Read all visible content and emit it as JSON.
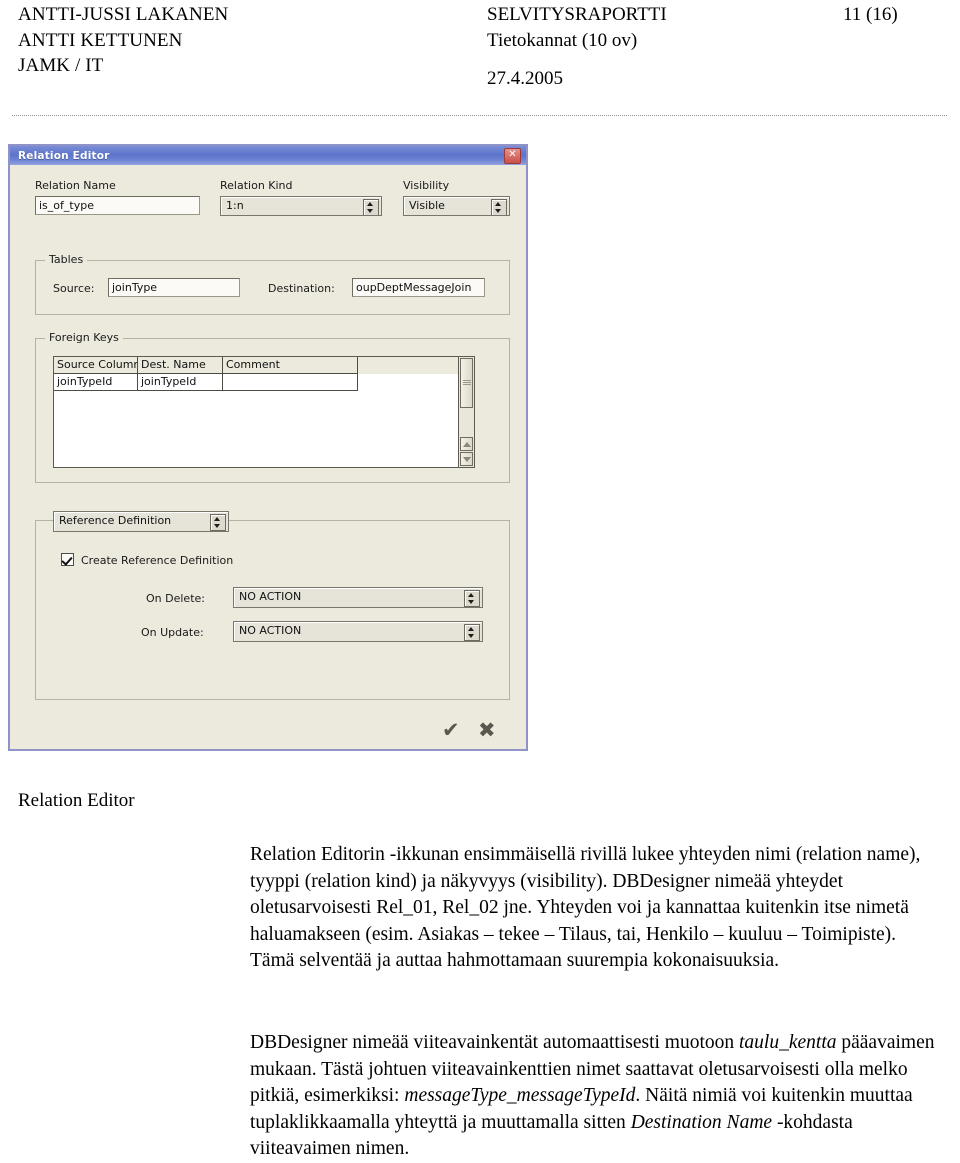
{
  "header": {
    "author_line_1": "ANTTI-JUSSI LAKANEN",
    "author_line_2": "ANTTI KETTUNEN",
    "org": "JAMK / IT",
    "doc_type": "SELVITYSRAPORTTI",
    "course": "Tietokannat (10 ov)",
    "date": "27.4.2005",
    "page": "11 (16)"
  },
  "dialog": {
    "title": "Relation Editor",
    "close_label": "✕",
    "relation_name_label": "Relation Name",
    "relation_name_value": "is_of_type",
    "relation_kind_label": "Relation Kind",
    "relation_kind_value": "1:n",
    "visibility_label": "Visibility",
    "visibility_value": "Visible",
    "tables_group": "Tables",
    "source_label": "Source:",
    "source_value": "joinType",
    "destination_label": "Destination:",
    "destination_value": "oupDeptMessageJoin",
    "foreign_keys_group": "Foreign Keys",
    "fk_columns": [
      "Source Column",
      "Dest. Name",
      "Comment"
    ],
    "fk_rows": [
      [
        "joinTypeId",
        "joinTypeId",
        ""
      ]
    ],
    "reference_definition_combo": "Reference Definition",
    "create_reference_definition_label": "Create Reference Definition",
    "create_reference_definition_checked": true,
    "on_delete_label": "On Delete:",
    "on_delete_value": "NO ACTION",
    "on_update_label": "On Update:",
    "on_update_value": "NO ACTION",
    "ok_icon": "✔",
    "cancel_icon": "✖"
  },
  "figure_caption": "Relation Editor",
  "body": {
    "paragraph_1_part_a": "Relation Editorin -ikkunan ensimmäisellä rivillä lukee yhteyden nimi (relation name), tyyppi (relation kind) ja näkyvyys (visibility). DBDesigner nimeää yhteydet oletusarvoisesti Rel_01, Rel_02 jne. Yhteyden voi ja kannattaa kuitenkin itse nimetä haluamakseen (esim. Asiakas – tekee – Tilaus, tai, Henkilo – kuuluu – Toimipiste). Tämä selventää ja auttaa hahmottamaan suurempia kokonaisuuksia.",
    "paragraph_2_part_a": "DBDesigner nimeää viiteavainkentät automaattisesti muotoon ",
    "paragraph_2_italic_1": "taulu_kentta",
    "paragraph_2_part_b": " pääavaimen mukaan. Tästä johtuen viiteavainkenttien nimet saattavat oletusarvoisesti olla melko pitkiä, esimerkiksi: ",
    "paragraph_2_italic_2": "messageType_messageTypeId",
    "paragraph_2_part_c": ". Näitä nimiä voi kuitenkin muuttaa tuplaklikkaamalla yhteyttä ja muuttamalla sitten ",
    "paragraph_2_italic_3": "Destination Name",
    "paragraph_2_part_d": " -kohdasta viiteavaimen nimen."
  }
}
